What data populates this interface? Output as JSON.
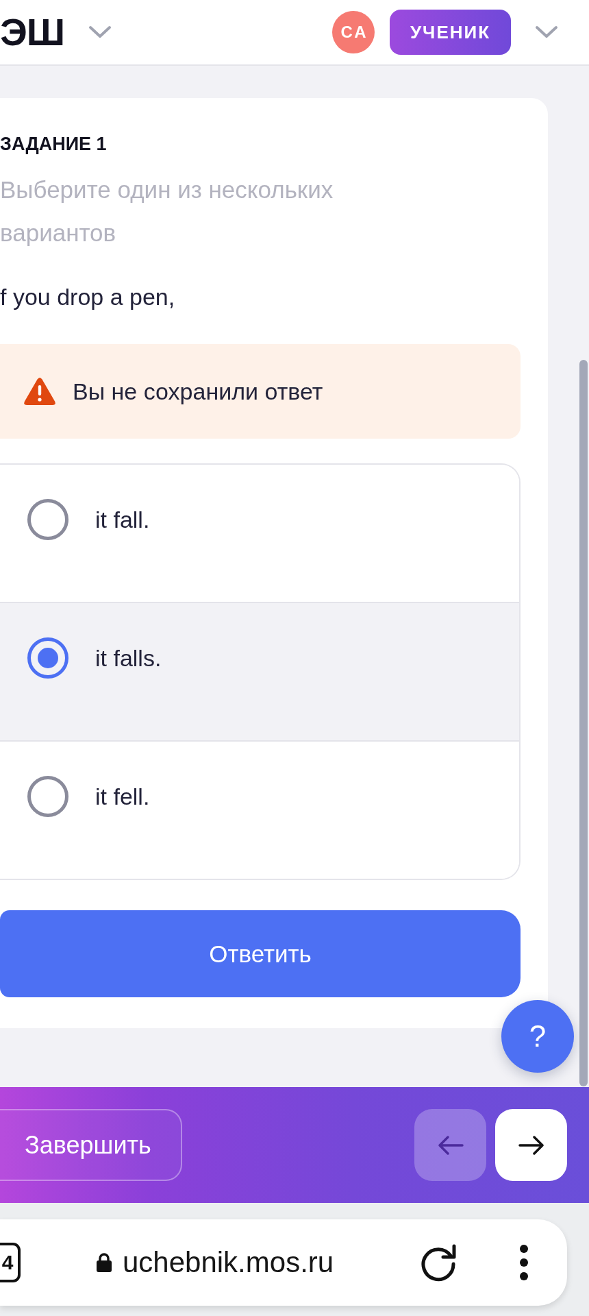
{
  "header": {
    "logo": "ЭШ",
    "avatar": "СА",
    "role_badge": "УЧЕНИК"
  },
  "task": {
    "title": "ЗАДАНИЕ 1",
    "instruction": "Выберите один из нескольких вариантов",
    "question": "f you drop a pen,"
  },
  "warning": {
    "text": "Вы не сохранили ответ"
  },
  "options": [
    {
      "label": "it fall.",
      "selected": false
    },
    {
      "label": "it falls.",
      "selected": true
    },
    {
      "label": "it fell.",
      "selected": false
    }
  ],
  "submit_button": "Ответить",
  "help_button": "?",
  "bottom_bar": {
    "finish_button": "Завершить"
  },
  "browser": {
    "tab_count": "4",
    "url": "uchebnik.mos.ru"
  }
}
